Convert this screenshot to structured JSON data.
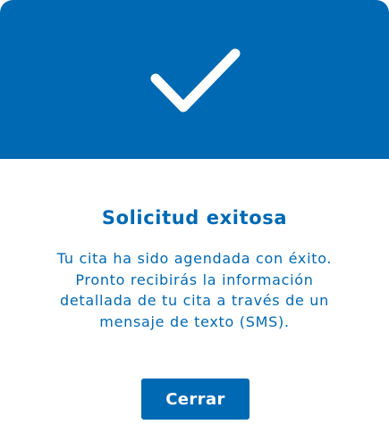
{
  "colors": {
    "primary": "#0069b4",
    "background": "#ffffff",
    "button_text": "#ffffff"
  },
  "dialog": {
    "icon": "checkmark-icon",
    "title": "Solicitud exitosa",
    "message": "Tu cita ha sido agendada con éxito. Pronto recibirás la información detallada de tu cita a través de un mensaje de texto (SMS).",
    "close_label": "Cerrar"
  }
}
